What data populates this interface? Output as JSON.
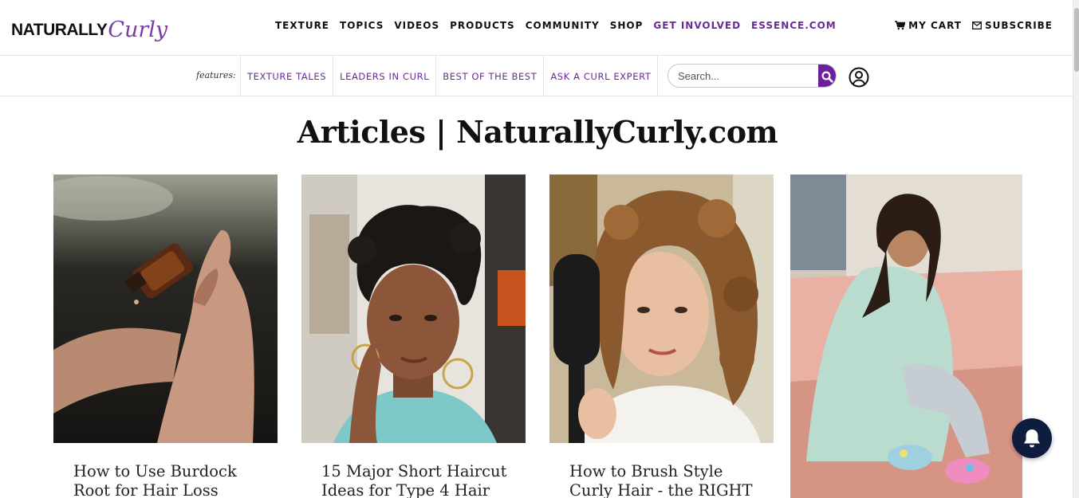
{
  "header": {
    "logo": {
      "part1": "NATURALLY",
      "part2": "Curly"
    },
    "nav": [
      {
        "label": "TEXTURE",
        "style": "normal"
      },
      {
        "label": "TOPICS",
        "style": "normal"
      },
      {
        "label": "VIDEOS",
        "style": "normal"
      },
      {
        "label": "PRODUCTS",
        "style": "normal"
      },
      {
        "label": "COMMUNITY",
        "style": "normal"
      },
      {
        "label": "SHOP",
        "style": "normal"
      },
      {
        "label": "GET INVOLVED",
        "style": "purple"
      },
      {
        "label": "ESSENCE.COM",
        "style": "purple"
      }
    ],
    "cart_label": "MY CART",
    "subscribe_label": "SUBSCRIBE"
  },
  "features": {
    "label": "features:",
    "links": [
      "TEXTURE TALES",
      "LEADERS IN CURL",
      "BEST OF THE BEST",
      "ASK A CURL EXPERT"
    ],
    "search_placeholder": "Search..."
  },
  "page": {
    "title": "Articles | NaturallyCurly.com"
  },
  "articles": [
    {
      "title": "How to Use Burdock Root for Hair Loss"
    },
    {
      "title": "15 Major Short Haircut Ideas for Type 4 Hair"
    },
    {
      "title": "How to Brush Style Curly Hair - the RIGHT Way"
    }
  ],
  "colors": {
    "brand_purple": "#6b2a9a",
    "search_button": "#6b1f9e",
    "bell_background": "#0e1c3e"
  },
  "icons": {
    "cart": "cart-icon",
    "subscribe": "envelope-icon",
    "search": "search-icon",
    "account": "user-circle-icon",
    "notifications": "bell-icon"
  }
}
